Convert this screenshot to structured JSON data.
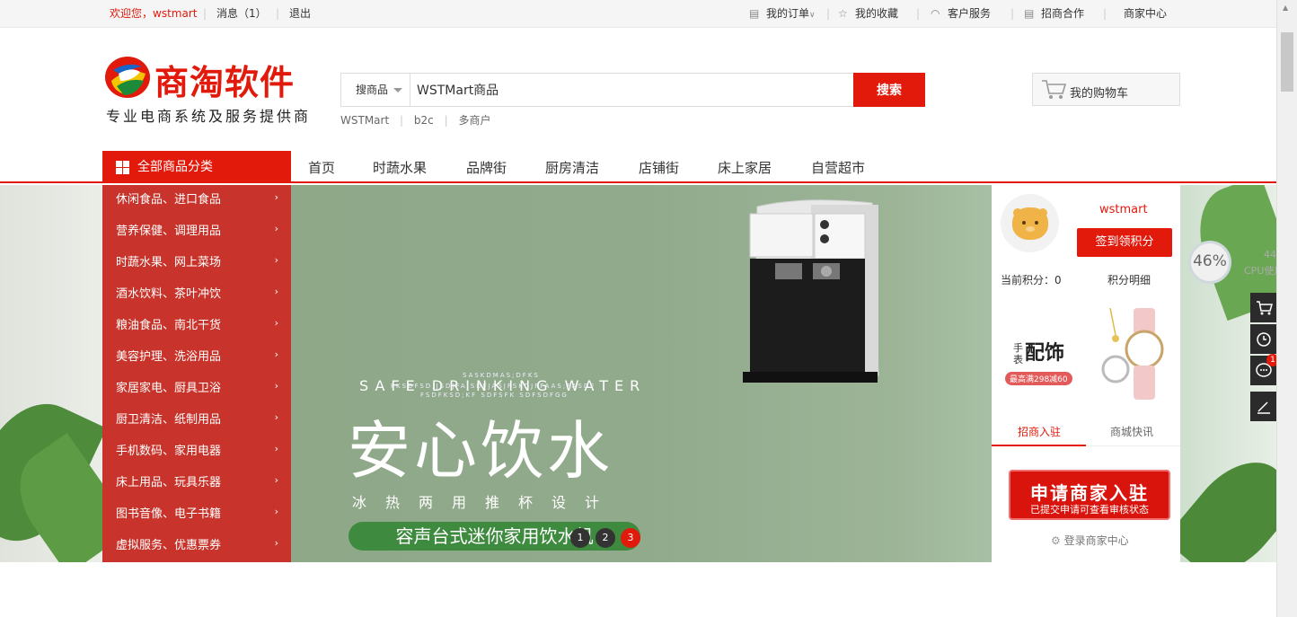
{
  "topbar": {
    "welcome": "欢迎您，wstmart",
    "messages": "消息（1）",
    "logout": "退出",
    "my_orders": "我的订单",
    "my_favorites": "我的收藏",
    "customer_service": "客户服务",
    "merchant_cooperation": "招商合作",
    "merchant_center": "商家中心"
  },
  "logo": {
    "name": "商淘软件",
    "slogan": "专业电商系统及服务提供商"
  },
  "search": {
    "type": "搜商品",
    "value": "WSTMart商品",
    "button": "搜索",
    "hotwords": [
      "WSTMart",
      "b2c",
      "多商户"
    ]
  },
  "cart": {
    "label": "我的购物车"
  },
  "nav": {
    "all_categories": "全部商品分类",
    "items": [
      "首页",
      "时蔬水果",
      "品牌街",
      "厨房清洁",
      "店铺街",
      "床上家居",
      "自营超市"
    ]
  },
  "categories": [
    "休闲食品、进口食品",
    "营养保健、调理用品",
    "时蔬水果、网上菜场",
    "酒水饮料、茶叶冲饮",
    "粮油食品、南北干货",
    "美容护理、洗浴用品",
    "家居家电、厨具卫浴",
    "厨卫清洁、纸制用品",
    "手机数码、家用电器",
    "床上用品、玩具乐器",
    "图书音像、电子书籍",
    "虚拟服务、优惠票券"
  ],
  "banner": {
    "english": "SAFE DRINKING WATER",
    "title": "安心饮水",
    "subtitle": "冰热两用推杯设计",
    "product": "容声台式迷你家用饮水机",
    "small_1": "SASKDMAS;DFKS",
    "small_2": "FKSDFSD;JSDJFAJSDFJASJFSKDJFFAAS;FASDF",
    "small_3": "FSDFKSD;KF SDFSFK SDFSDFGG",
    "dots": [
      "1",
      "2",
      "3"
    ]
  },
  "user_panel": {
    "username": "wstmart",
    "sign_button": "签到领积分",
    "current_points": "当前积分：0",
    "points_detail": "积分明细",
    "promo_small_1": "手",
    "promo_small_2": "表",
    "promo_title": "配饰",
    "promo_deal": "最高满298减60",
    "tabs": [
      "招商入驻",
      "商城快讯"
    ],
    "join_title": "申请商家入驻",
    "join_sub": "已提交申请可查看审核状态",
    "login_merchant": "登录商家中心"
  },
  "monitor": {
    "cpu": "46%",
    "cpu_small": "44%",
    "cpu_label": "CPU使用"
  },
  "sidebar_badge": "1",
  "colors": {
    "brand_red": "#e11a0c",
    "category_panel": "#c8342b"
  }
}
